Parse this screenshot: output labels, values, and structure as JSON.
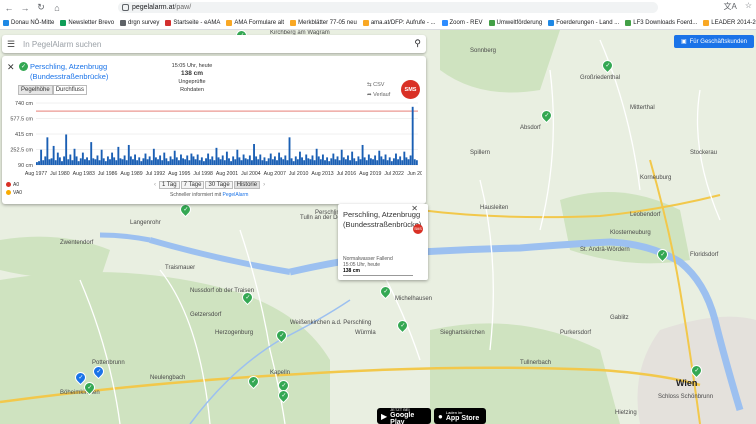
{
  "browser": {
    "url_host": "pegelalarm.at",
    "url_path": "/paw/",
    "bookmarks": [
      {
        "label": "Donau NÖ-Mitte",
        "color": "#1e88e5"
      },
      {
        "label": "Newsletter Brevo",
        "color": "#0f9d58"
      },
      {
        "label": "drgn survey",
        "color": "#5f6368"
      },
      {
        "label": "Startseite - eAMA",
        "color": "#d32f2f"
      },
      {
        "label": "AMA Formulare alt",
        "color": "#f9a825"
      },
      {
        "label": "Merkblätter 77-05 neu",
        "color": "#f9a825"
      },
      {
        "label": "ama.at/DFP: Aufrufe - ...",
        "color": "#f9a825"
      },
      {
        "label": "Zoom - REV",
        "color": "#2d8cff"
      },
      {
        "label": "Umweltförderung",
        "color": "#43a047"
      },
      {
        "label": "Foerderungen - Land ...",
        "color": "#1e88e5"
      },
      {
        "label": "LF3 Downloads Foerd...",
        "color": "#43a047"
      },
      {
        "label": "LEADER 2014-2020",
        "color": "#f9a825"
      }
    ]
  },
  "search": {
    "placeholder": "In PegelAlarm suchen",
    "menu_icon": "hamburger-icon",
    "search_icon": "search-icon"
  },
  "business_button": "Für Geschäftskunden",
  "panel": {
    "station_name": "Perschling, Atzenbrugg (Bundesstraßenbrücke)",
    "tabs": [
      "Pegelhöhe",
      "Durchfluss"
    ],
    "active_tab": 0,
    "timestamp": "15:05 Uhr, heute",
    "current_value": "138 cm",
    "status_line1": "Ungeprüfte",
    "status_line2": "Rohdaten",
    "csv_label": "CSV",
    "history_label": "Verlauf",
    "sms_label": "SMS",
    "legend": [
      {
        "label": "A0",
        "color": "#d93025"
      },
      {
        "label": "VA0",
        "color": "#f9ab00"
      }
    ],
    "range_buttons": [
      "1 Tag",
      "7 Tage",
      "30 Tage",
      "Historie"
    ],
    "active_range": 3,
    "powered_prefix": "Schneller informiert mit",
    "powered_brand": "PegelAlarm"
  },
  "chart_data": {
    "type": "bar",
    "title": "",
    "ylabel": "",
    "xlabel": "",
    "yticks": [
      "740 cm",
      "577.5 cm",
      "415 cm",
      "252.5 cm",
      "90 cm"
    ],
    "ytick_values": [
      740,
      577.5,
      415,
      252.5,
      90
    ],
    "ylim": [
      90,
      740
    ],
    "xticks": [
      "Aug 1977",
      "Jul 1980",
      "Aug 1983",
      "Jul 1986",
      "Aug 1989",
      "Jul 1992",
      "Aug 1995",
      "Jul 1998",
      "Aug 2001",
      "Jul 2004",
      "Aug 2007",
      "Jul 2010",
      "Aug 2013",
      "Jul 2016",
      "Aug 2019",
      "Jul 2022",
      "Jun 2025"
    ],
    "threshold_lines": [
      {
        "label": "A0",
        "value": 655,
        "color": "#d93025"
      }
    ],
    "series": [
      {
        "color": "#1a5fb4",
        "values": [
          120,
          130,
          250,
          140,
          180,
          380,
          150,
          160,
          290,
          140,
          220,
          170,
          130,
          180,
          410,
          150,
          200,
          140,
          260,
          180,
          130,
          160,
          220,
          150,
          170,
          140,
          330,
          160,
          150,
          190,
          140,
          250,
          160,
          130,
          180,
          150,
          220,
          170,
          140,
          280,
          160,
          150,
          190,
          140,
          300,
          180,
          150,
          200,
          140,
          170,
          130,
          160,
          210,
          150,
          180,
          140,
          260,
          170,
          150,
          190,
          140,
          220,
          160,
          130,
          180,
          150,
          240,
          170,
          140,
          200,
          160,
          150,
          190,
          140,
          210,
          180,
          150,
          200,
          140,
          170,
          130,
          160,
          210,
          150,
          180,
          140,
          270,
          170,
          150,
          190,
          140,
          230,
          160,
          130,
          180,
          150,
          250,
          170,
          140,
          200,
          160,
          150,
          190,
          140,
          310,
          180,
          150,
          200,
          140,
          170,
          130,
          160,
          210,
          150,
          180,
          140,
          220,
          170,
          150,
          190,
          140,
          380,
          160,
          130,
          180,
          150,
          230,
          170,
          140,
          200,
          160,
          150,
          190,
          140,
          260,
          180,
          150,
          200,
          140,
          170,
          130,
          160,
          210,
          150,
          180,
          140,
          250,
          170,
          150,
          190,
          140,
          230,
          160,
          130,
          180,
          150,
          300,
          170,
          140,
          200,
          160,
          150,
          190,
          140,
          240,
          180,
          150,
          200,
          140,
          170,
          130,
          160,
          210,
          150,
          180,
          140,
          230,
          170,
          150,
          190,
          700,
          150,
          140
        ]
      }
    ]
  },
  "popup": {
    "station_name": "Perschling, Atzenbrugg (Bundesstraßenbrücke)",
    "status": "Normalwasser Fallend",
    "timestamp": "15:05 Uhr, heute",
    "value": "138 cm",
    "sms_label": "SMS"
  },
  "map": {
    "places": [
      {
        "name": "Sonnberg"
      },
      {
        "name": "Großriedenthal"
      },
      {
        "name": "Mitterthal"
      },
      {
        "name": "Kirchberg am Wagram"
      },
      {
        "name": "Absdorf"
      },
      {
        "name": "Stockerau"
      },
      {
        "name": "Tulln an der Donau"
      },
      {
        "name": "Langenrohr"
      },
      {
        "name": "Zwentendorf"
      },
      {
        "name": "Herzogenburg"
      },
      {
        "name": "Traismauer"
      },
      {
        "name": "Neulengbach"
      },
      {
        "name": "Böheimkirchen"
      },
      {
        "name": "Michelhausen"
      },
      {
        "name": "Sieghartskirchen"
      },
      {
        "name": "Purkersdorf"
      },
      {
        "name": "Tullnerbach"
      },
      {
        "name": "Gablitz"
      },
      {
        "name": "Klosterneuburg"
      },
      {
        "name": "Korneuburg"
      },
      {
        "name": "Floridsdorf"
      },
      {
        "name": "Wien"
      },
      {
        "name": "Hietzing"
      },
      {
        "name": "Schloss Schönbrunn"
      },
      {
        "name": "Perschling"
      },
      {
        "name": "St. Andrä-Wördern"
      },
      {
        "name": "Würmla"
      },
      {
        "name": "Weißenkirchen a.d. Perschling"
      },
      {
        "name": "Pottenbrunn"
      },
      {
        "name": "Getzersdorf"
      },
      {
        "name": "Nussdorf ob der Traisen"
      },
      {
        "name": "Kapelln"
      },
      {
        "name": "Hausleiten"
      },
      {
        "name": "Leobendorf"
      },
      {
        "name": "Spillern"
      }
    ]
  },
  "app_store": {
    "google_small": "JETZT BEI",
    "google_big": "Google Play",
    "apple_small": "Laden im",
    "apple_big": "App Store"
  }
}
